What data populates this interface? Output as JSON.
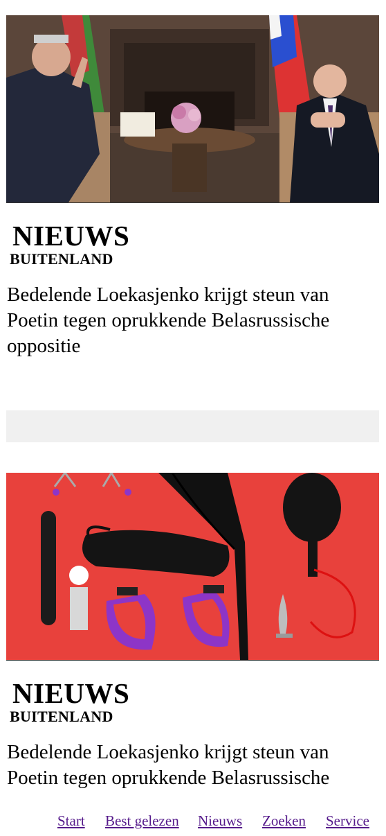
{
  "articles": [
    {
      "section": "NIEUWS",
      "subsection": "BUITENLAND",
      "headline": "Bedelende Loekasjenko krijgt steun van Poetin tegen oprukkende Belasrussische oppositie"
    },
    {
      "section": "NIEUWS",
      "subsection": "BUITENLAND",
      "headline": "Bedelende Loekasjenko krijgt steun van Poetin tegen oprukkende Belasrussische oppositie"
    }
  ],
  "bottom_nav": {
    "start": "Start",
    "best_read": "Best gelezen",
    "news": "Nieuws",
    "search": "Zoeken",
    "service": "Service"
  },
  "colors": {
    "link": "#551a8b",
    "ad_placeholder": "#f0f0f0",
    "photo2_background": "#e8413c"
  }
}
